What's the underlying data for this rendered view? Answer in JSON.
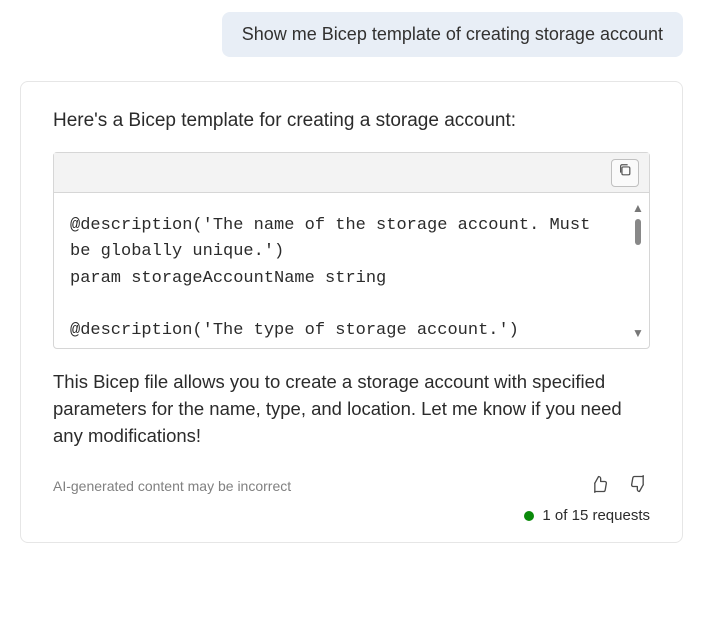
{
  "user_message": "Show me Bicep template of creating storage account",
  "assistant": {
    "intro": "Here's a Bicep template for creating a storage account:",
    "code": "@description('The name of the storage account. Must be globally unique.')\nparam storageAccountName string\n\n@description('The type of storage account.')",
    "followup": "This Bicep file allows you to create a storage account with specified parameters for the name, type, and location. Let me know if you need any modifications!"
  },
  "footer": {
    "disclaimer": "AI-generated content may be incorrect",
    "request_count": "1 of 15 requests"
  }
}
